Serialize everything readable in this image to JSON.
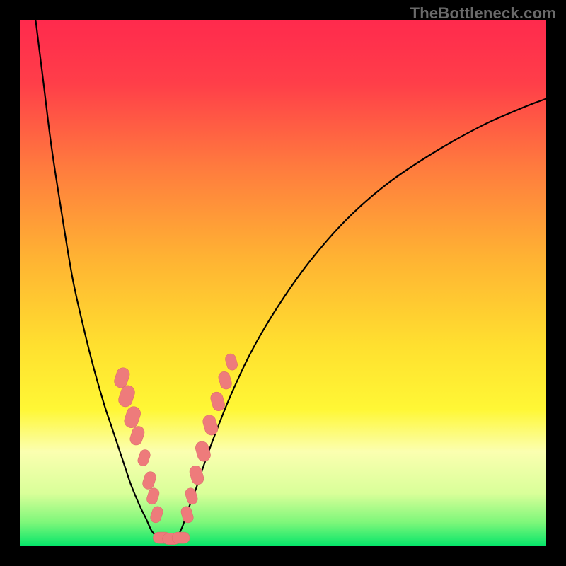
{
  "watermark": "TheBottleneck.com",
  "chart_data": {
    "type": "line",
    "title": "",
    "xlabel": "",
    "ylabel": "",
    "xlim": [
      0,
      100
    ],
    "ylim": [
      0,
      100
    ],
    "background_gradient_stops": [
      {
        "offset": 0.0,
        "color": "#ff2a4d"
      },
      {
        "offset": 0.12,
        "color": "#ff3e49"
      },
      {
        "offset": 0.28,
        "color": "#ff7b3e"
      },
      {
        "offset": 0.45,
        "color": "#ffb233"
      },
      {
        "offset": 0.62,
        "color": "#ffe02f"
      },
      {
        "offset": 0.74,
        "color": "#fff735"
      },
      {
        "offset": 0.82,
        "color": "#fbffb0"
      },
      {
        "offset": 0.9,
        "color": "#d9ff99"
      },
      {
        "offset": 0.955,
        "color": "#7df77a"
      },
      {
        "offset": 1.0,
        "color": "#05e56a"
      }
    ],
    "series": [
      {
        "name": "curve-left",
        "x": [
          3.0,
          4.5,
          6.0,
          8.0,
          10.0,
          12.0,
          14.0,
          16.0,
          17.5,
          19.0,
          20.0,
          21.0,
          22.0,
          23.0,
          24.0,
          25.0,
          26.0
        ],
        "y": [
          100.0,
          88.0,
          76.0,
          63.0,
          51.0,
          42.0,
          34.0,
          27.0,
          22.5,
          18.0,
          15.0,
          12.0,
          9.5,
          7.2,
          5.2,
          3.0,
          1.8
        ]
      },
      {
        "name": "curve-right",
        "x": [
          30.0,
          31.0,
          32.0,
          33.5,
          35.0,
          37.0,
          40.0,
          44.0,
          49.0,
          55.0,
          62.0,
          70.0,
          79.0,
          88.0,
          96.0,
          100.0
        ],
        "y": [
          1.8,
          4.0,
          7.0,
          11.0,
          15.5,
          21.0,
          28.5,
          37.0,
          45.5,
          54.0,
          62.0,
          69.0,
          75.0,
          80.0,
          83.5,
          85.0
        ]
      }
    ],
    "markers": [
      {
        "name": "left-marker-1",
        "x": 19.4,
        "y": 32.0,
        "size": 3.2
      },
      {
        "name": "left-marker-2",
        "x": 20.3,
        "y": 28.5,
        "size": 3.4
      },
      {
        "name": "left-marker-3",
        "x": 21.4,
        "y": 24.5,
        "size": 3.4
      },
      {
        "name": "left-marker-4",
        "x": 22.3,
        "y": 21.0,
        "size": 3.0
      },
      {
        "name": "left-marker-5",
        "x": 23.6,
        "y": 16.8,
        "size": 2.6
      },
      {
        "name": "left-marker-6",
        "x": 24.6,
        "y": 12.5,
        "size": 2.8
      },
      {
        "name": "left-marker-7",
        "x": 25.3,
        "y": 9.5,
        "size": 2.6
      },
      {
        "name": "left-marker-8",
        "x": 26.0,
        "y": 6.0,
        "size": 2.6
      },
      {
        "name": "bottom-marker-1",
        "x": 27.0,
        "y": 1.6,
        "size": 2.8
      },
      {
        "name": "bottom-marker-2",
        "x": 28.8,
        "y": 1.4,
        "size": 2.8
      },
      {
        "name": "bottom-marker-3",
        "x": 30.6,
        "y": 1.6,
        "size": 2.8
      },
      {
        "name": "right-marker-1",
        "x": 31.8,
        "y": 6.0,
        "size": 2.6
      },
      {
        "name": "right-marker-2",
        "x": 32.6,
        "y": 9.5,
        "size": 2.6
      },
      {
        "name": "right-marker-3",
        "x": 33.6,
        "y": 13.5,
        "size": 3.0
      },
      {
        "name": "right-marker-4",
        "x": 34.8,
        "y": 18.0,
        "size": 3.2
      },
      {
        "name": "right-marker-5",
        "x": 36.2,
        "y": 23.0,
        "size": 3.2
      },
      {
        "name": "right-marker-6",
        "x": 37.6,
        "y": 27.5,
        "size": 3.0
      },
      {
        "name": "right-marker-7",
        "x": 39.0,
        "y": 31.5,
        "size": 2.8
      },
      {
        "name": "right-marker-8",
        "x": 40.2,
        "y": 35.0,
        "size": 2.6
      }
    ],
    "marker_fill": "#ee7b7b",
    "marker_stroke": "#d86a6a",
    "curve_stroke": "#000000",
    "curve_width": 2.2
  }
}
